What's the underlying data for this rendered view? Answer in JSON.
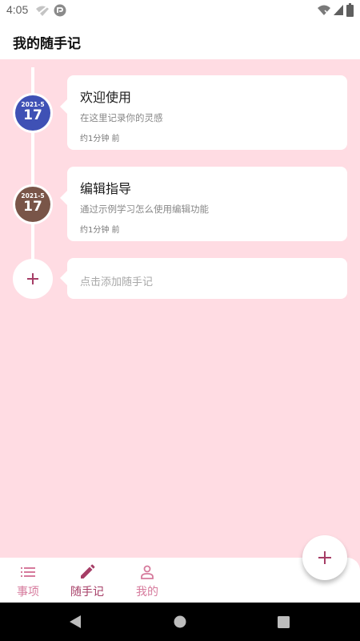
{
  "status_bar": {
    "time": "4:05",
    "notification_icons": [
      "wifi-off-icon",
      "app-notification-icon"
    ],
    "system_icons": [
      "wifi-icon",
      "signal-icon",
      "battery-icon"
    ]
  },
  "app_bar": {
    "title": "我的随手记"
  },
  "colors": {
    "background": "#ffdce3",
    "accent": "#a63d66",
    "badge_blue": "#3f51b5",
    "badge_brown": "#795548",
    "nav_inactive": "#d67a9c"
  },
  "notes": [
    {
      "title": "欢迎使用",
      "description": "在这里记录你的灵感",
      "time": "约1分钟 前",
      "date_month": "2021-5",
      "date_day": "17",
      "badge_color": "#3f51b5"
    },
    {
      "title": "编辑指导",
      "description": "通过示例学习怎么使用编辑功能",
      "time": "约1分钟 前",
      "date_month": "2021-5",
      "date_day": "17",
      "badge_color": "#795548"
    }
  ],
  "add_note": {
    "label": "点击添加随手记",
    "icon": "plus-icon"
  },
  "bottom_nav": {
    "items": [
      {
        "label": "事项",
        "icon": "list-icon",
        "active": false
      },
      {
        "label": "随手记",
        "icon": "pencil-icon",
        "active": true
      },
      {
        "label": "我的",
        "icon": "person-icon",
        "active": false
      }
    ]
  },
  "fab": {
    "icon": "plus-icon"
  },
  "system_nav": [
    "back-icon",
    "home-icon",
    "recents-icon"
  ]
}
